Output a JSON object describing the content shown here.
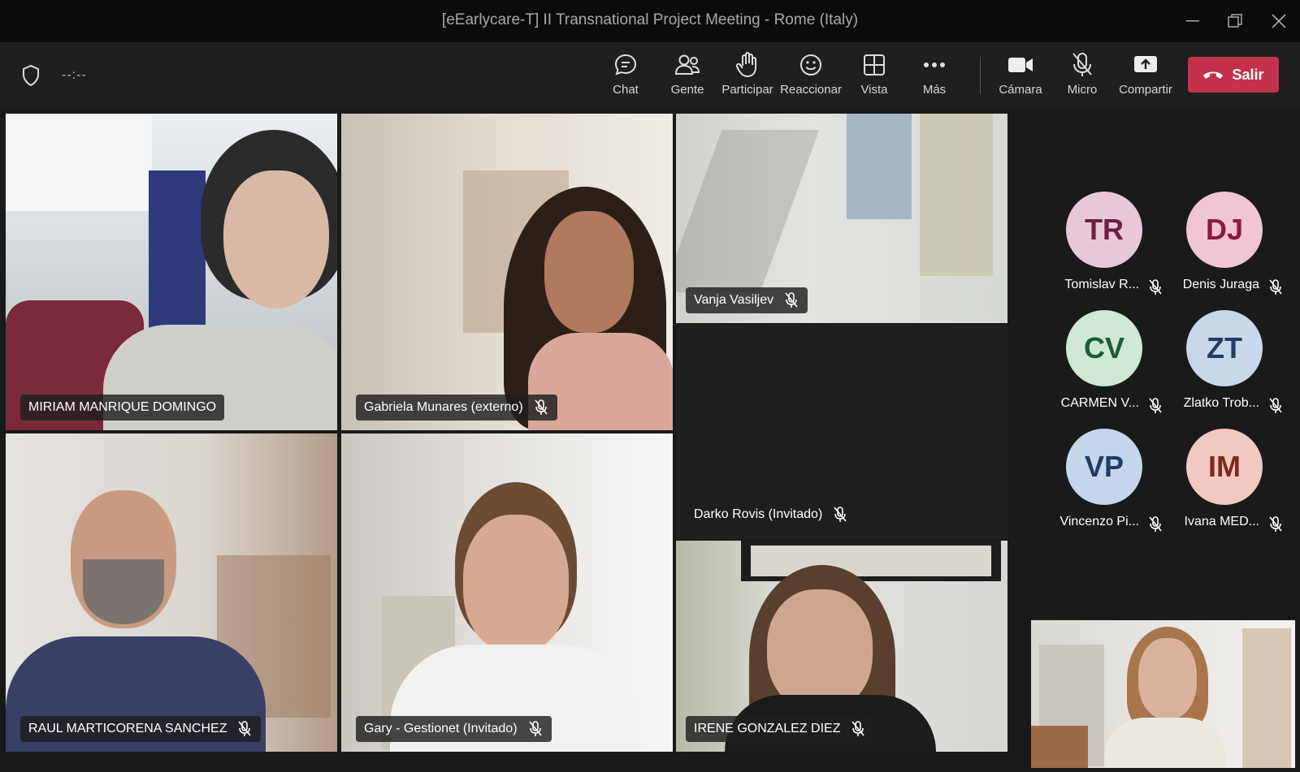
{
  "window": {
    "title": "[eEarlycare-T] II Transnational Project Meeting - Rome (Italy)"
  },
  "toolbar": {
    "timer": "--:--",
    "buttons": [
      {
        "label": "Chat",
        "icon": "chat-icon"
      },
      {
        "label": "Gente",
        "icon": "people-icon"
      },
      {
        "label": "Participar",
        "icon": "raise-hand-icon"
      },
      {
        "label": "Reaccionar",
        "icon": "smiley-icon"
      },
      {
        "label": "Vista",
        "icon": "grid-view-icon"
      },
      {
        "label": "Más",
        "icon": "more-icon"
      },
      {
        "label": "Cámara",
        "icon": "camera-icon"
      },
      {
        "label": "Micro",
        "icon": "mic-off-icon"
      },
      {
        "label": "Compartir",
        "icon": "share-icon"
      }
    ],
    "leave_label": "Salir",
    "leave_color": "#c4314b"
  },
  "tiles": [
    {
      "name": "MIRIAM MANRIQUE DOMINGO",
      "muted": false
    },
    {
      "name": "Gabriela Munares (externo)",
      "muted": true
    },
    {
      "name": "Vanja Vasiljev",
      "muted": true
    },
    {
      "name": "Darko Rovis (Invitado)",
      "muted": true
    },
    {
      "name": "RAUL MARTICORENA SANCHEZ",
      "muted": true
    },
    {
      "name": "Gary - Gestionet (Invitado)",
      "muted": true
    },
    {
      "name": "IRENE GONZALEZ DIEZ",
      "muted": true
    }
  ],
  "avatars": [
    {
      "initials": "TR",
      "name": "Tomislav R...",
      "bg": "#e8c8d8",
      "fg": "#6b2142"
    },
    {
      "initials": "DJ",
      "name": "Denis Juraga",
      "bg": "#f1c5d4",
      "fg": "#8a1a3e"
    },
    {
      "initials": "CV",
      "name": "CARMEN V...",
      "bg": "#cfe8d6",
      "fg": "#1d5c37"
    },
    {
      "initials": "ZT",
      "name": "Zlatko Trob...",
      "bg": "#c9d7ea",
      "fg": "#1f3e66"
    },
    {
      "initials": "VP",
      "name": "Vincenzo Pi...",
      "bg": "#c6d6ea",
      "fg": "#1d3d68"
    },
    {
      "initials": "IM",
      "name": "Ivana MED...",
      "bg": "#f2c9c0",
      "fg": "#7c2a1a"
    }
  ]
}
